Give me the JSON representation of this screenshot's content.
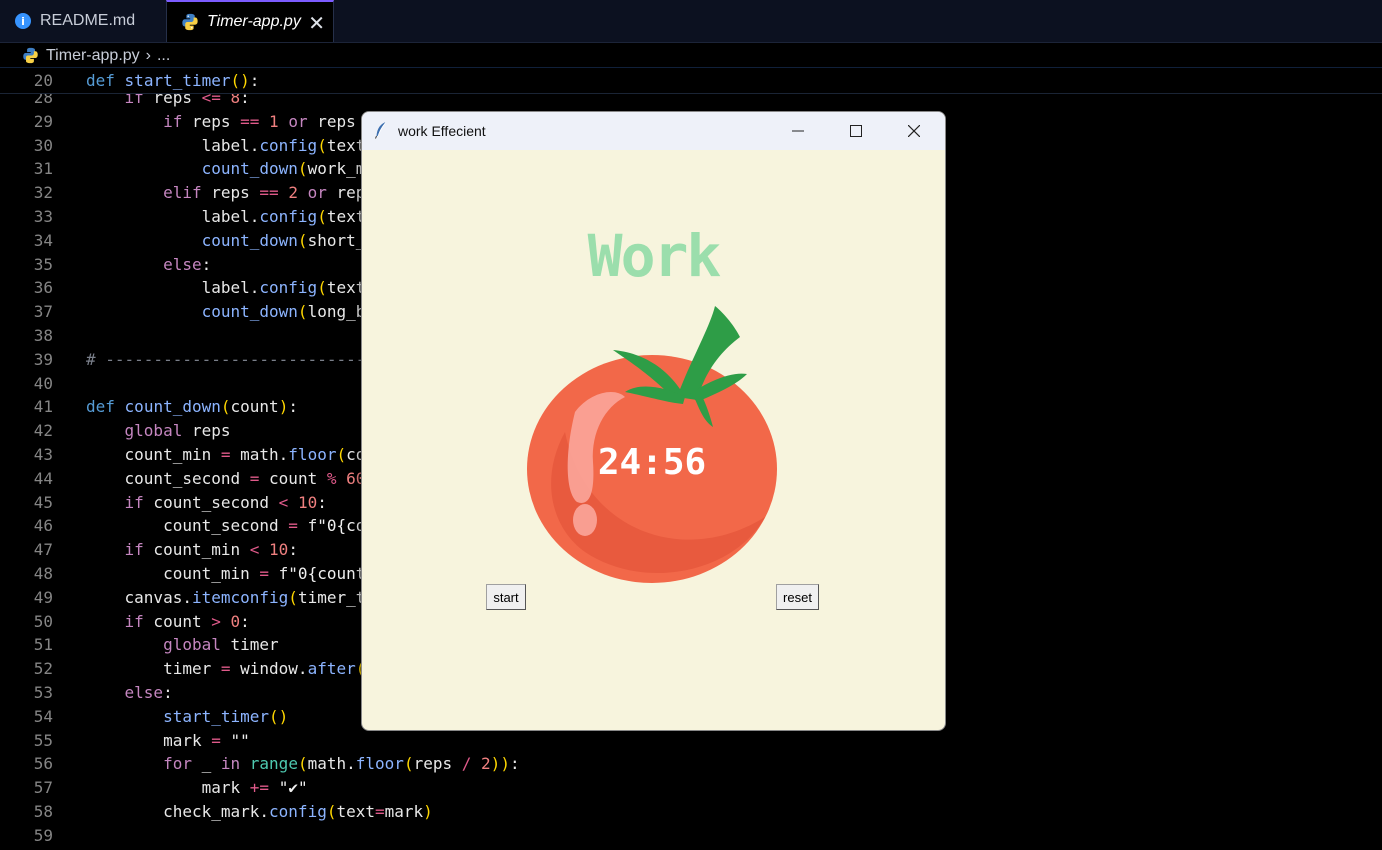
{
  "tabs": [
    {
      "label": "README.md",
      "icon": "info-icon"
    },
    {
      "label": "Timer-app.py",
      "icon": "python-icon",
      "active": true
    }
  ],
  "breadcrumb": {
    "file": "Timer-app.py",
    "more": "..."
  },
  "code_lines": [
    {
      "n": "20",
      "text": "def start_timer():"
    },
    {
      "n": "28",
      "text": "    if reps <= 8:"
    },
    {
      "n": "29",
      "text": "        if reps == 1 or reps"
    },
    {
      "n": "30",
      "text": "            label.config(text"
    },
    {
      "n": "31",
      "text": "            count_down(work_m"
    },
    {
      "n": "32",
      "text": "        elif reps == 2 or rep"
    },
    {
      "n": "33",
      "text": "            label.config(text"
    },
    {
      "n": "34",
      "text": "            count_down(short_"
    },
    {
      "n": "35",
      "text": "        else:"
    },
    {
      "n": "36",
      "text": "            label.config(text"
    },
    {
      "n": "37",
      "text": "            count_down(long_b"
    },
    {
      "n": "38",
      "text": ""
    },
    {
      "n": "39",
      "text": "# ------------------------------"
    },
    {
      "n": "40",
      "text": ""
    },
    {
      "n": "41",
      "text": "def count_down(count):"
    },
    {
      "n": "42",
      "text": "    global reps"
    },
    {
      "n": "43",
      "text": "    count_min = math.floor(co"
    },
    {
      "n": "44",
      "text": "    count_second = count % 60"
    },
    {
      "n": "45",
      "text": "    if count_second < 10:"
    },
    {
      "n": "46",
      "text": "        count_second = f\"0{co"
    },
    {
      "n": "47",
      "text": "    if count_min < 10:"
    },
    {
      "n": "48",
      "text": "        count_min = f\"0{count"
    },
    {
      "n": "49",
      "text": "    canvas.itemconfig(timer_t"
    },
    {
      "n": "50",
      "text": "    if count > 0:"
    },
    {
      "n": "51",
      "text": "        global timer"
    },
    {
      "n": "52",
      "text": "        timer = window.after("
    },
    {
      "n": "53",
      "text": "    else:"
    },
    {
      "n": "54",
      "text": "        start_timer()"
    },
    {
      "n": "55",
      "text": "        mark = \"\""
    },
    {
      "n": "56",
      "text": "        for _ in range(math.floor(reps / 2)):"
    },
    {
      "n": "57",
      "text": "            mark += \"✔\""
    },
    {
      "n": "58",
      "text": "        check_mark.config(text=mark)"
    },
    {
      "n": "59",
      "text": ""
    }
  ],
  "tk_window": {
    "title": "work Effecient",
    "heading": "Work",
    "timer": "24:56",
    "start_label": "start",
    "reset_label": "reset",
    "colors": {
      "background": "#f7f4dd",
      "heading": "#9bdeac",
      "tomato": "#f26849",
      "leaf": "#2e9d47"
    }
  },
  "theme": {
    "accent": "#7c5cff",
    "keyword": "#c586c0",
    "function": "#8cb4ff"
  }
}
